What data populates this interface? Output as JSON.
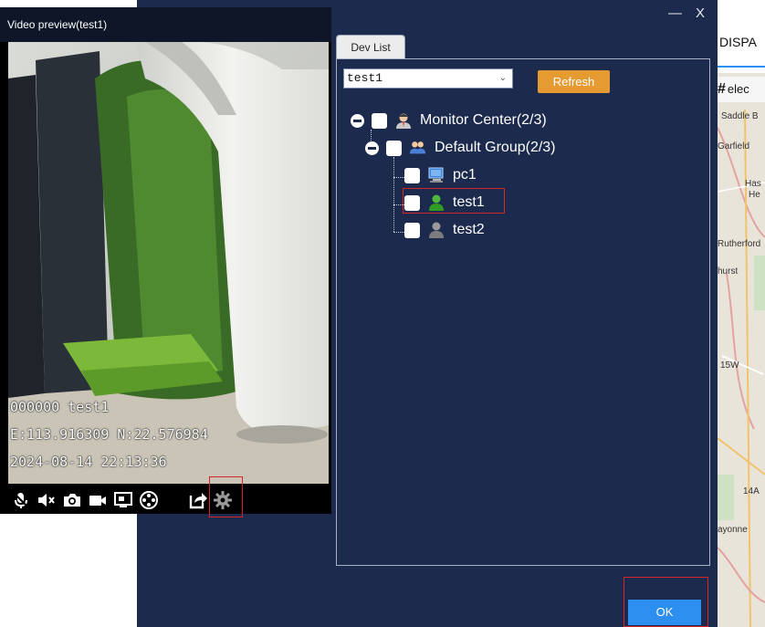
{
  "video_preview": {
    "title": "Video preview(test1)",
    "overlay": {
      "device_line": "000000 test1",
      "coords": "E:113.916309 N:22.576984",
      "datetime": "2024-08-14 22:13:36"
    },
    "controls": [
      "microphone-icon",
      "mute-icon",
      "camera-icon",
      "record-icon",
      "screen-icon",
      "reel-icon",
      "share-icon",
      "settings-icon"
    ]
  },
  "dialog": {
    "minimize_label": "—",
    "close_label": "X",
    "tab_label": "Dev List",
    "select_value": "test1",
    "refresh_label": "Refresh",
    "ok_label": "OK",
    "tree": {
      "root": "Monitor Center(2/3)",
      "group": "Default Group(2/3)",
      "devices": [
        {
          "name": "pc1",
          "icon": "pc-icon"
        },
        {
          "name": "test1",
          "icon": "user-online-icon"
        },
        {
          "name": "test2",
          "icon": "user-offline-icon"
        }
      ]
    }
  },
  "map": {
    "tab_label": "DISPA",
    "tool_label": "elec",
    "labels": [
      "Saddle B",
      "Garfield",
      "Has",
      "He",
      "Rutherford",
      "hurst",
      "15W",
      "14A",
      "ayonne"
    ]
  },
  "colors": {
    "dialog_bg": "#1c2a4d",
    "accent_orange": "#e59a32",
    "accent_blue": "#2d8ff0",
    "highlight_red": "#d6262a"
  }
}
